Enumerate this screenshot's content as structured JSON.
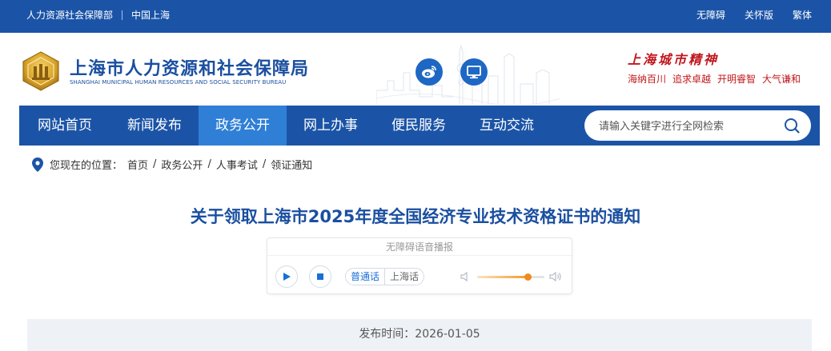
{
  "topbar": {
    "left_links": [
      "人力资源社会保障部",
      "中国上海"
    ],
    "right_links": [
      "无障碍",
      "关怀版",
      "繁体"
    ]
  },
  "header": {
    "title": "上海市人力资源和社会保障局",
    "subtitle": "SHANGHAI MUNICIPAL HUMAN RESOURCES AND SOCIAL SECURITY BUREAU",
    "icons": [
      "weibo-icon",
      "monitor-icon"
    ],
    "slogan_title": "上海城市精神",
    "slogan_items": [
      "海纳百川",
      "追求卓越",
      "开明睿智",
      "大气谦和"
    ]
  },
  "nav": {
    "items": [
      {
        "label": "网站首页",
        "active": false
      },
      {
        "label": "新闻发布",
        "active": false
      },
      {
        "label": "政务公开",
        "active": true
      },
      {
        "label": "网上办事",
        "active": false
      },
      {
        "label": "便民服务",
        "active": false
      },
      {
        "label": "互动交流",
        "active": false
      }
    ],
    "search_placeholder": "请输入关键字进行全网检索"
  },
  "breadcrumb": {
    "label": "您现在的位置：",
    "items": [
      "首页",
      "政务公开",
      "人事考试",
      "领证通知"
    ],
    "separator": "/"
  },
  "article": {
    "title": "关于领取上海市2025年度全国经济专业技术资格证书的通知",
    "publish": "发布时间：2026-01-05"
  },
  "player": {
    "title": "无障碍语音播报",
    "languages": [
      "普通话",
      "上海话"
    ],
    "selected_language": "普通话",
    "volume": 0.75
  },
  "colors": {
    "primary": "#1b54a7",
    "nav_active": "#2f7fd6",
    "accent_red": "#c0171c",
    "volume_orange": "#f08a1c"
  }
}
